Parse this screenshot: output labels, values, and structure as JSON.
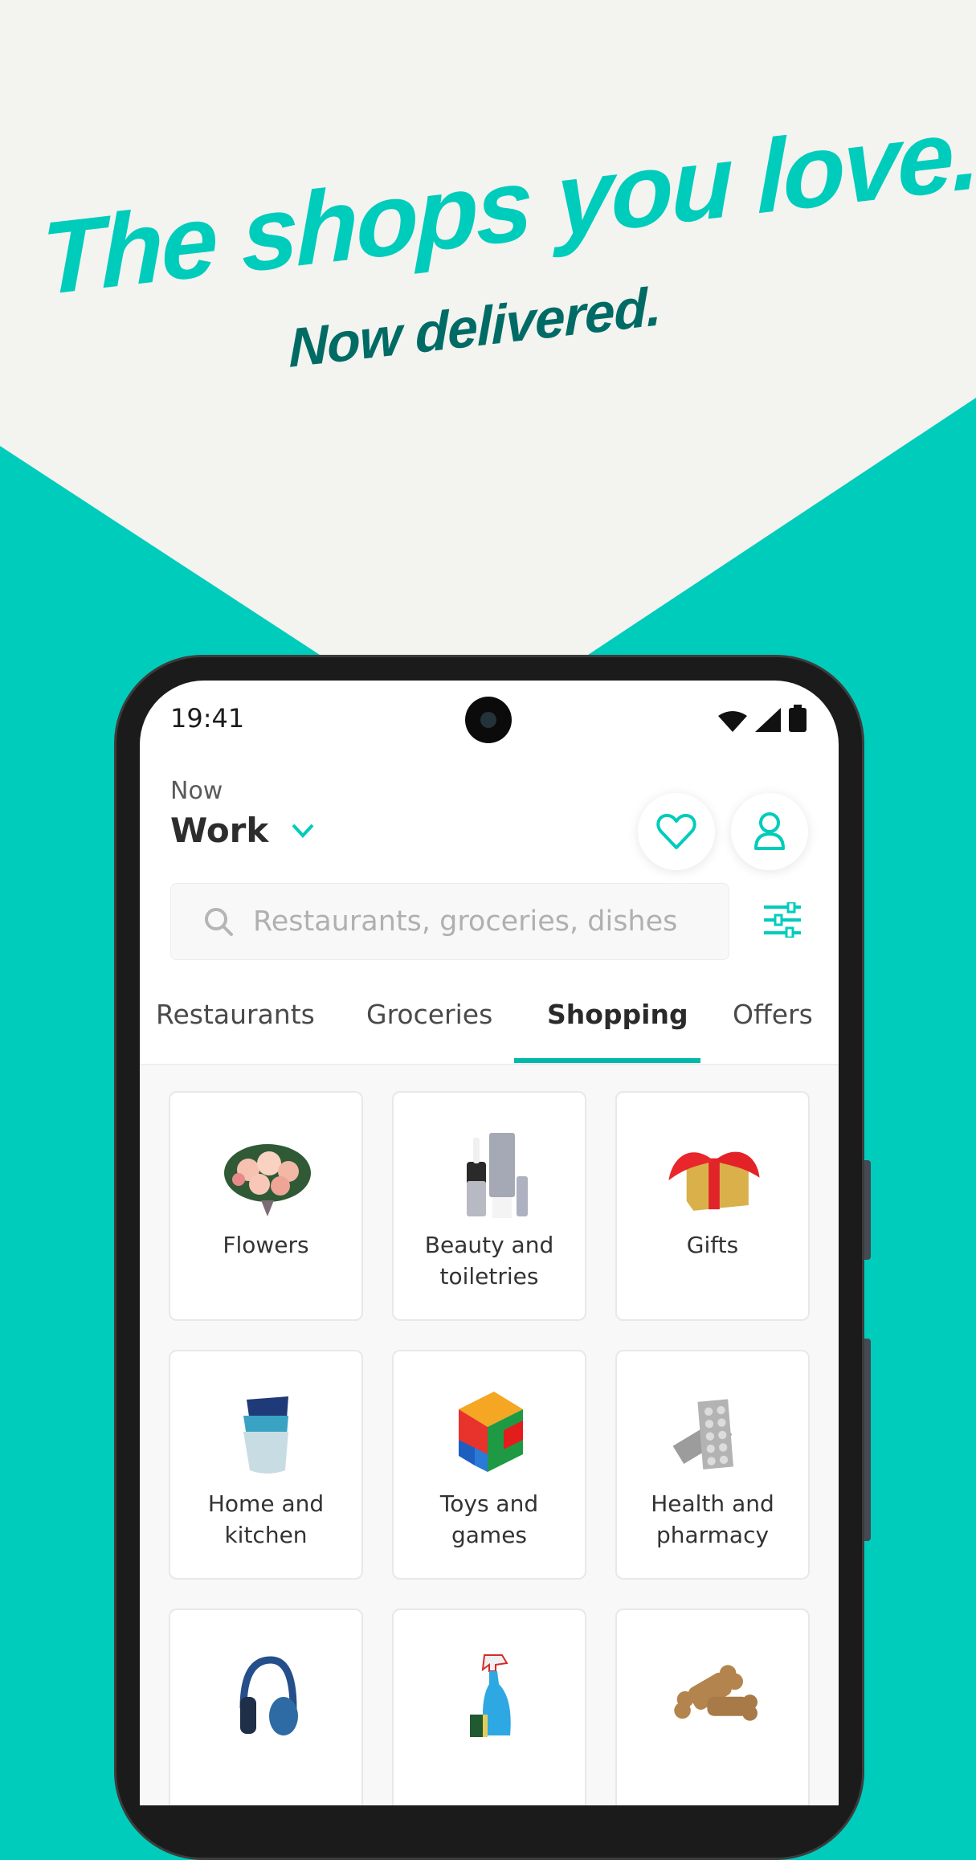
{
  "colors": {
    "brand_teal": "#00CCBC",
    "dark_teal": "#006B65",
    "cream": "#F3F3EF",
    "tab_underline": "#00B8A9"
  },
  "headline": {
    "line1": "The shops you love.",
    "line2": "Now delivered."
  },
  "status_bar": {
    "time": "19:41",
    "icons": [
      "wifi-icon",
      "signal-icon",
      "battery-icon"
    ]
  },
  "location": {
    "label": "Now",
    "value": "Work"
  },
  "header_buttons": [
    {
      "name": "favourites",
      "icon": "heart-icon"
    },
    {
      "name": "account",
      "icon": "person-icon"
    }
  ],
  "search": {
    "placeholder": "Restaurants, groceries, dishes",
    "value": ""
  },
  "tabs": [
    {
      "label": "Restaurants",
      "active": false
    },
    {
      "label": "Groceries",
      "active": false
    },
    {
      "label": "Shopping",
      "active": true
    },
    {
      "label": "Offers",
      "active": false
    }
  ],
  "categories": [
    {
      "label": "Flowers",
      "image": "flower-bouquet"
    },
    {
      "label": "Beauty and toiletries",
      "image": "cosmetic-bottles"
    },
    {
      "label": "Gifts",
      "image": "gift-box"
    },
    {
      "label": "Home and kitchen",
      "image": "stacked-bowls"
    },
    {
      "label": "Toys and games",
      "image": "toy-bricks"
    },
    {
      "label": "Health and pharmacy",
      "image": "pill-blister-packs"
    },
    {
      "label": "",
      "image": "headphones"
    },
    {
      "label": "",
      "image": "cleaning-spray"
    },
    {
      "label": "",
      "image": "dog-biscuits"
    }
  ]
}
